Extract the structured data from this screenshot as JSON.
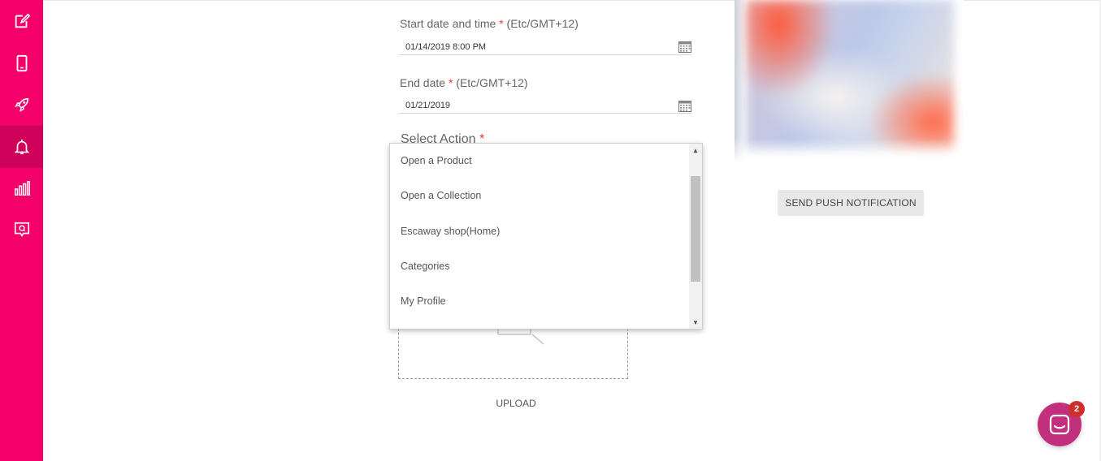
{
  "sidebar": {
    "items": [
      {
        "icon": "edit-icon",
        "active": false
      },
      {
        "icon": "phone-icon",
        "active": false
      },
      {
        "icon": "rocket-icon",
        "active": false
      },
      {
        "icon": "bell-icon",
        "active": true
      },
      {
        "icon": "bar-chart-icon",
        "active": false
      },
      {
        "icon": "search-message-icon",
        "active": false
      }
    ],
    "color": "#f4006a",
    "active_color": "#cf005a"
  },
  "form": {
    "start": {
      "label": "Start date and time ",
      "required_mark": "*",
      "tz": " (Etc/GMT+12)",
      "value": "01/14/2019 8:00 PM"
    },
    "end": {
      "label": "End date ",
      "required_mark": "*",
      "tz": " (Etc/GMT+12)",
      "value": "01/21/2019"
    },
    "select_action": {
      "label": "Select Action ",
      "required_mark": "*"
    },
    "dropdown_options": [
      "Open a Product",
      "Open a Collection",
      "Escaway shop(Home)",
      "Categories",
      "My Profile"
    ],
    "upload_label": "UPLOAD"
  },
  "preview": {
    "send_button_label": "SEND PUSH NOTIFICATION"
  },
  "chat": {
    "badge_count": "2",
    "color": "#c2307d"
  }
}
